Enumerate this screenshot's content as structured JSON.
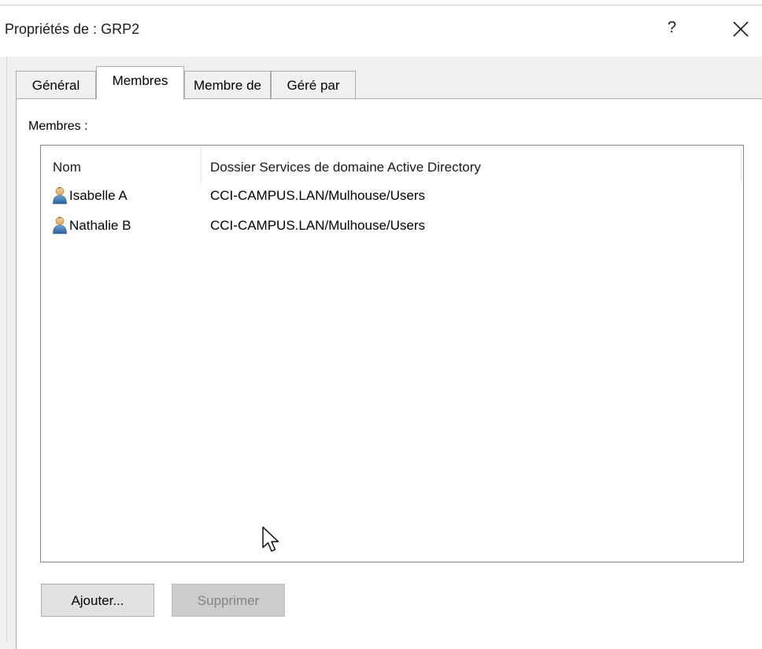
{
  "window": {
    "title": "Propriétés de : GRP2",
    "help_label": "?",
    "close_icon": "close-icon"
  },
  "tabs": [
    {
      "label": "Général",
      "active": false
    },
    {
      "label": "Membres",
      "active": true
    },
    {
      "label": "Membre de",
      "active": false
    },
    {
      "label": "Géré par",
      "active": false
    }
  ],
  "members": {
    "label": "Membres :",
    "columns": [
      "Nom",
      "Dossier Services de domaine Active Directory"
    ],
    "rows": [
      {
        "name": "Isabelle A",
        "folder": "CCI-CAMPUS.LAN/Mulhouse/Users",
        "icon": "user-icon"
      },
      {
        "name": "Nathalie B",
        "folder": "CCI-CAMPUS.LAN/Mulhouse/Users",
        "icon": "user-icon"
      }
    ]
  },
  "buttons": {
    "add_label": "Ajouter...",
    "remove_label": "Supprimer",
    "remove_enabled": false
  },
  "colors": {
    "panel_bg": "#ffffff",
    "window_bg": "#f0f0f0",
    "border": "#adadad",
    "disabled_text": "#838383"
  }
}
